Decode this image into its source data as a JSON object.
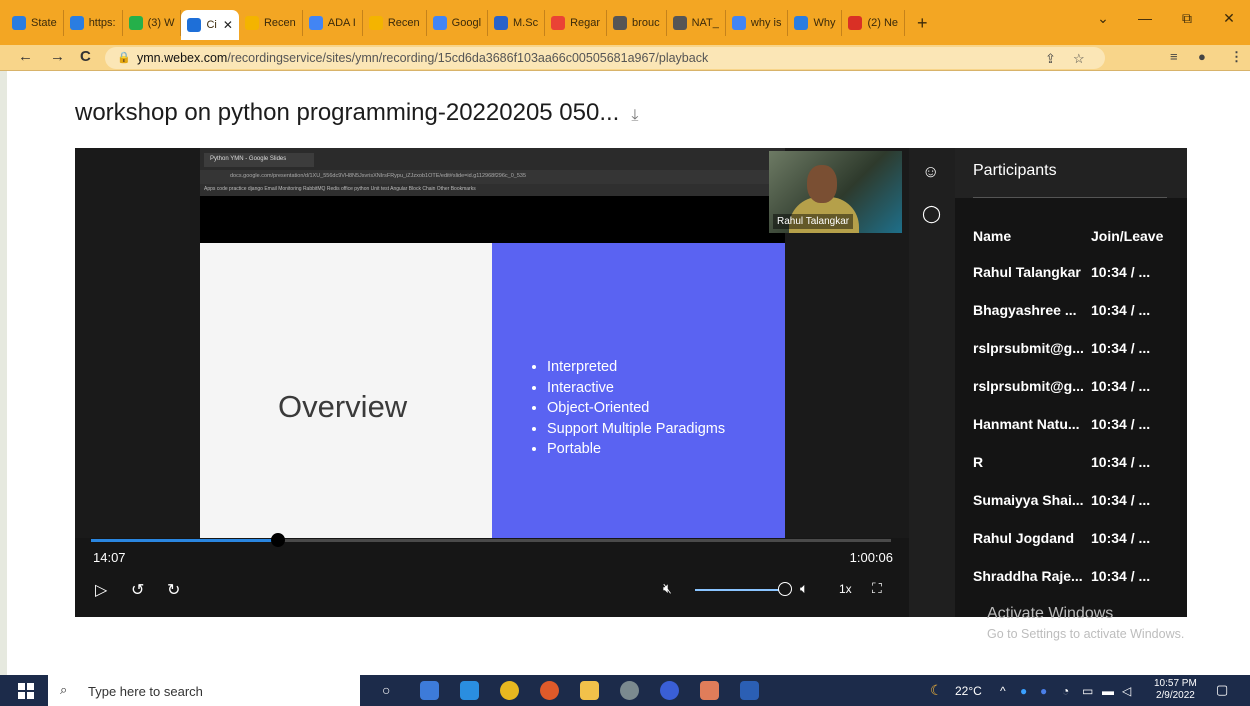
{
  "browser": {
    "tabs": [
      {
        "label": "State",
        "color": "#2a7de1"
      },
      {
        "label": "https:",
        "color": "#2a7de1"
      },
      {
        "label": "(3) W",
        "color": "#25b04a"
      },
      {
        "label": "Ci",
        "color": "#1e6fd8",
        "active": true
      },
      {
        "label": "Recen",
        "color": "#f4b400"
      },
      {
        "label": "ADA I",
        "color": "#4285f4"
      },
      {
        "label": "Recen",
        "color": "#f4b400"
      },
      {
        "label": "Googl",
        "color": "#4285f4"
      },
      {
        "label": "M.Sc",
        "color": "#2962c9"
      },
      {
        "label": "Regar",
        "color": "#ea4335"
      },
      {
        "label": "brouc",
        "color": "#555555"
      },
      {
        "label": "NAT_",
        "color": "#555555"
      },
      {
        "label": "why is",
        "color": "#4285f4"
      },
      {
        "label": "Why",
        "color": "#2a7de1"
      },
      {
        "label": "(2) Ne",
        "color": "#d93025"
      }
    ],
    "active_tab_close": "✕",
    "new_tab": "+",
    "window_controls": {
      "dropdown": "⌄",
      "minimize": "—",
      "restore": "⧉",
      "close": "✕"
    },
    "url_host": "ymn.webex.com",
    "url_path": "/recordingservice/sites/ymn/recording/15cd6da3686f103aa66c00505681a967/playback",
    "nav": {
      "back": "←",
      "forward": "→",
      "reload": "C"
    }
  },
  "recording": {
    "title": "workshop on python programming-20220205 050...",
    "download_icon": "⤓"
  },
  "shared_screen": {
    "tab_label": "Python YMN - Google Slides",
    "url": "docs.google.com/presentation/d/1XU_556dc9VH8N5JsvrisXNIrsFRypu_iZJzxob1OTE/edit#slide=id.g112968f296c_0_535",
    "bookmarks": "Apps   code practice   django   Email Monitoring   RabbitMQ   Redis   office   python   Unit test   Angular   Block Chain      Other Bookmarks",
    "slide_title": "Overview",
    "bullets": [
      "Interpreted",
      "Interactive",
      "Object-Oriented",
      "Support Multiple Paradigms",
      "Portable"
    ]
  },
  "camera": {
    "name": "Rahul Talangkar"
  },
  "player": {
    "current_time": "14:07",
    "total_time": "1:00:06",
    "progress_fraction": 0.234,
    "speed": "1x",
    "volume_fraction": 1.0
  },
  "participants": {
    "title": "Participants",
    "col_name": "Name",
    "col_join": "Join/Leave",
    "rows": [
      {
        "name": "Rahul Talangkar",
        "time": "10:34 / ..."
      },
      {
        "name": "Bhagyashree ...",
        "time": "10:34 / ..."
      },
      {
        "name": "rslprsubmit@g...",
        "time": "10:34 / ..."
      },
      {
        "name": "rslprsubmit@g...",
        "time": "10:34 / ..."
      },
      {
        "name": "Hanmant Natu...",
        "time": "10:34 / ..."
      },
      {
        "name": "R",
        "time": "10:34 / ..."
      },
      {
        "name": "Sumaiyya Shai...",
        "time": "10:34 / ..."
      },
      {
        "name": "Rahul Jogdand",
        "time": "10:34 / ..."
      },
      {
        "name": "Shraddha Raje...",
        "time": "10:34 / ..."
      }
    ]
  },
  "watermark": {
    "line1": "Activate Windows",
    "line2": "Go to Settings to activate Windows."
  },
  "taskbar": {
    "search_placeholder": "Type here to search",
    "temperature": "22°C",
    "time": "10:57 PM",
    "date": "2/9/2022"
  }
}
